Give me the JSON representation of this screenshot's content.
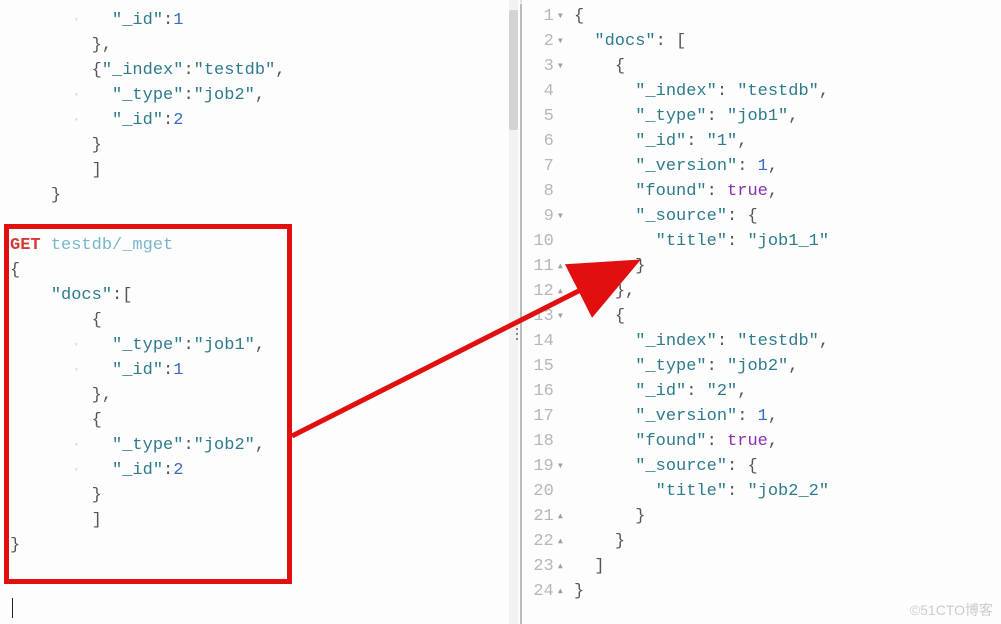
{
  "left": {
    "top_lines": [
      {
        "indent": 5,
        "tokens": [
          {
            "t": "key",
            "v": "\"_id\""
          },
          {
            "t": "punct",
            "v": ":"
          },
          {
            "t": "num",
            "v": "1"
          }
        ],
        "guide": true
      },
      {
        "indent": 4,
        "tokens": [
          {
            "t": "punct",
            "v": "},"
          }
        ]
      },
      {
        "indent": 4,
        "tokens": [
          {
            "t": "punct",
            "v": "{"
          },
          {
            "t": "key",
            "v": "\"_index\""
          },
          {
            "t": "punct",
            "v": ":"
          },
          {
            "t": "str",
            "v": "\"testdb\""
          },
          {
            "t": "punct",
            "v": ","
          }
        ]
      },
      {
        "indent": 5,
        "tokens": [
          {
            "t": "key",
            "v": "\"_type\""
          },
          {
            "t": "punct",
            "v": ":"
          },
          {
            "t": "str",
            "v": "\"job2\""
          },
          {
            "t": "punct",
            "v": ","
          }
        ],
        "guide": true
      },
      {
        "indent": 5,
        "tokens": [
          {
            "t": "key",
            "v": "\"_id\""
          },
          {
            "t": "punct",
            "v": ":"
          },
          {
            "t": "num",
            "v": "2"
          }
        ],
        "guide": true
      },
      {
        "indent": 4,
        "tokens": [
          {
            "t": "punct",
            "v": "}"
          }
        ]
      },
      {
        "indent": 4,
        "tokens": [
          {
            "t": "punct",
            "v": "]"
          }
        ]
      },
      {
        "indent": 2,
        "tokens": [
          {
            "t": "punct",
            "v": "}"
          }
        ]
      }
    ],
    "request_line": {
      "method": "GET",
      "path": "testdb/_mget"
    },
    "body_lines": [
      {
        "indent": 0,
        "tokens": [
          {
            "t": "punct",
            "v": "{"
          }
        ]
      },
      {
        "indent": 2,
        "tokens": [
          {
            "t": "key",
            "v": "\"docs\""
          },
          {
            "t": "punct",
            "v": ":["
          }
        ]
      },
      {
        "indent": 4,
        "tokens": [
          {
            "t": "punct",
            "v": "{"
          }
        ]
      },
      {
        "indent": 5,
        "tokens": [
          {
            "t": "key",
            "v": "\"_type\""
          },
          {
            "t": "punct",
            "v": ":"
          },
          {
            "t": "str",
            "v": "\"job1\""
          },
          {
            "t": "punct",
            "v": ","
          }
        ],
        "guide": true
      },
      {
        "indent": 5,
        "tokens": [
          {
            "t": "key",
            "v": "\"_id\""
          },
          {
            "t": "punct",
            "v": ":"
          },
          {
            "t": "num",
            "v": "1"
          }
        ],
        "guide": true
      },
      {
        "indent": 4,
        "tokens": [
          {
            "t": "punct",
            "v": "},"
          }
        ]
      },
      {
        "indent": 4,
        "tokens": [
          {
            "t": "punct",
            "v": "{"
          }
        ]
      },
      {
        "indent": 5,
        "tokens": [
          {
            "t": "key",
            "v": "\"_type\""
          },
          {
            "t": "punct",
            "v": ":"
          },
          {
            "t": "str",
            "v": "\"job2\""
          },
          {
            "t": "punct",
            "v": ","
          }
        ],
        "guide": true
      },
      {
        "indent": 5,
        "tokens": [
          {
            "t": "key",
            "v": "\"_id\""
          },
          {
            "t": "punct",
            "v": ":"
          },
          {
            "t": "num",
            "v": "2"
          }
        ],
        "guide": true
      },
      {
        "indent": 4,
        "tokens": [
          {
            "t": "punct",
            "v": "}"
          }
        ]
      },
      {
        "indent": 4,
        "tokens": [
          {
            "t": "punct",
            "v": "]"
          }
        ]
      },
      {
        "indent": 0,
        "tokens": [
          {
            "t": "punct",
            "v": "}"
          }
        ]
      }
    ]
  },
  "right": {
    "lines": [
      {
        "num": 1,
        "fold": "▾",
        "indent": 0,
        "tokens": [
          {
            "t": "punct",
            "v": "{"
          }
        ]
      },
      {
        "num": 2,
        "fold": "▾",
        "indent": 2,
        "tokens": [
          {
            "t": "key",
            "v": "\"docs\""
          },
          {
            "t": "punct",
            "v": ": ["
          }
        ]
      },
      {
        "num": 3,
        "fold": "▾",
        "indent": 4,
        "tokens": [
          {
            "t": "punct",
            "v": "{"
          }
        ]
      },
      {
        "num": 4,
        "fold": "",
        "indent": 6,
        "tokens": [
          {
            "t": "key",
            "v": "\"_index\""
          },
          {
            "t": "punct",
            "v": ": "
          },
          {
            "t": "str",
            "v": "\"testdb\""
          },
          {
            "t": "punct",
            "v": ","
          }
        ]
      },
      {
        "num": 5,
        "fold": "",
        "indent": 6,
        "tokens": [
          {
            "t": "key",
            "v": "\"_type\""
          },
          {
            "t": "punct",
            "v": ": "
          },
          {
            "t": "str",
            "v": "\"job1\""
          },
          {
            "t": "punct",
            "v": ","
          }
        ]
      },
      {
        "num": 6,
        "fold": "",
        "indent": 6,
        "tokens": [
          {
            "t": "key",
            "v": "\"_id\""
          },
          {
            "t": "punct",
            "v": ": "
          },
          {
            "t": "str",
            "v": "\"1\""
          },
          {
            "t": "punct",
            "v": ","
          }
        ]
      },
      {
        "num": 7,
        "fold": "",
        "indent": 6,
        "tokens": [
          {
            "t": "key",
            "v": "\"_version\""
          },
          {
            "t": "punct",
            "v": ": "
          },
          {
            "t": "num",
            "v": "1"
          },
          {
            "t": "punct",
            "v": ","
          }
        ]
      },
      {
        "num": 8,
        "fold": "",
        "indent": 6,
        "tokens": [
          {
            "t": "key",
            "v": "\"found\""
          },
          {
            "t": "punct",
            "v": ": "
          },
          {
            "t": "bool",
            "v": "true"
          },
          {
            "t": "punct",
            "v": ","
          }
        ]
      },
      {
        "num": 9,
        "fold": "▾",
        "indent": 6,
        "tokens": [
          {
            "t": "key",
            "v": "\"_source\""
          },
          {
            "t": "punct",
            "v": ": {"
          }
        ]
      },
      {
        "num": 10,
        "fold": "",
        "indent": 8,
        "tokens": [
          {
            "t": "key",
            "v": "\"title\""
          },
          {
            "t": "punct",
            "v": ": "
          },
          {
            "t": "str",
            "v": "\"job1_1\""
          }
        ]
      },
      {
        "num": 11,
        "fold": "▴",
        "indent": 6,
        "tokens": [
          {
            "t": "punct",
            "v": "}"
          }
        ]
      },
      {
        "num": 12,
        "fold": "▴",
        "indent": 4,
        "tokens": [
          {
            "t": "punct",
            "v": "},"
          }
        ]
      },
      {
        "num": 13,
        "fold": "▾",
        "indent": 4,
        "tokens": [
          {
            "t": "punct",
            "v": "{"
          }
        ]
      },
      {
        "num": 14,
        "fold": "",
        "indent": 6,
        "tokens": [
          {
            "t": "key",
            "v": "\"_index\""
          },
          {
            "t": "punct",
            "v": ": "
          },
          {
            "t": "str",
            "v": "\"testdb\""
          },
          {
            "t": "punct",
            "v": ","
          }
        ]
      },
      {
        "num": 15,
        "fold": "",
        "indent": 6,
        "tokens": [
          {
            "t": "key",
            "v": "\"_type\""
          },
          {
            "t": "punct",
            "v": ": "
          },
          {
            "t": "str",
            "v": "\"job2\""
          },
          {
            "t": "punct",
            "v": ","
          }
        ]
      },
      {
        "num": 16,
        "fold": "",
        "indent": 6,
        "tokens": [
          {
            "t": "key",
            "v": "\"_id\""
          },
          {
            "t": "punct",
            "v": ": "
          },
          {
            "t": "str",
            "v": "\"2\""
          },
          {
            "t": "punct",
            "v": ","
          }
        ]
      },
      {
        "num": 17,
        "fold": "",
        "indent": 6,
        "tokens": [
          {
            "t": "key",
            "v": "\"_version\""
          },
          {
            "t": "punct",
            "v": ": "
          },
          {
            "t": "num",
            "v": "1"
          },
          {
            "t": "punct",
            "v": ","
          }
        ]
      },
      {
        "num": 18,
        "fold": "",
        "indent": 6,
        "tokens": [
          {
            "t": "key",
            "v": "\"found\""
          },
          {
            "t": "punct",
            "v": ": "
          },
          {
            "t": "bool",
            "v": "true"
          },
          {
            "t": "punct",
            "v": ","
          }
        ]
      },
      {
        "num": 19,
        "fold": "▾",
        "indent": 6,
        "tokens": [
          {
            "t": "key",
            "v": "\"_source\""
          },
          {
            "t": "punct",
            "v": ": {"
          }
        ]
      },
      {
        "num": 20,
        "fold": "",
        "indent": 8,
        "tokens": [
          {
            "t": "key",
            "v": "\"title\""
          },
          {
            "t": "punct",
            "v": ": "
          },
          {
            "t": "str",
            "v": "\"job2_2\""
          }
        ]
      },
      {
        "num": 21,
        "fold": "▴",
        "indent": 6,
        "tokens": [
          {
            "t": "punct",
            "v": "}"
          }
        ]
      },
      {
        "num": 22,
        "fold": "▴",
        "indent": 4,
        "tokens": [
          {
            "t": "punct",
            "v": "}"
          }
        ]
      },
      {
        "num": 23,
        "fold": "▴",
        "indent": 2,
        "tokens": [
          {
            "t": "punct",
            "v": "]"
          }
        ]
      },
      {
        "num": 24,
        "fold": "▴",
        "indent": 0,
        "tokens": [
          {
            "t": "punct",
            "v": "}"
          }
        ]
      }
    ]
  },
  "watermark": "©51CTO博客"
}
